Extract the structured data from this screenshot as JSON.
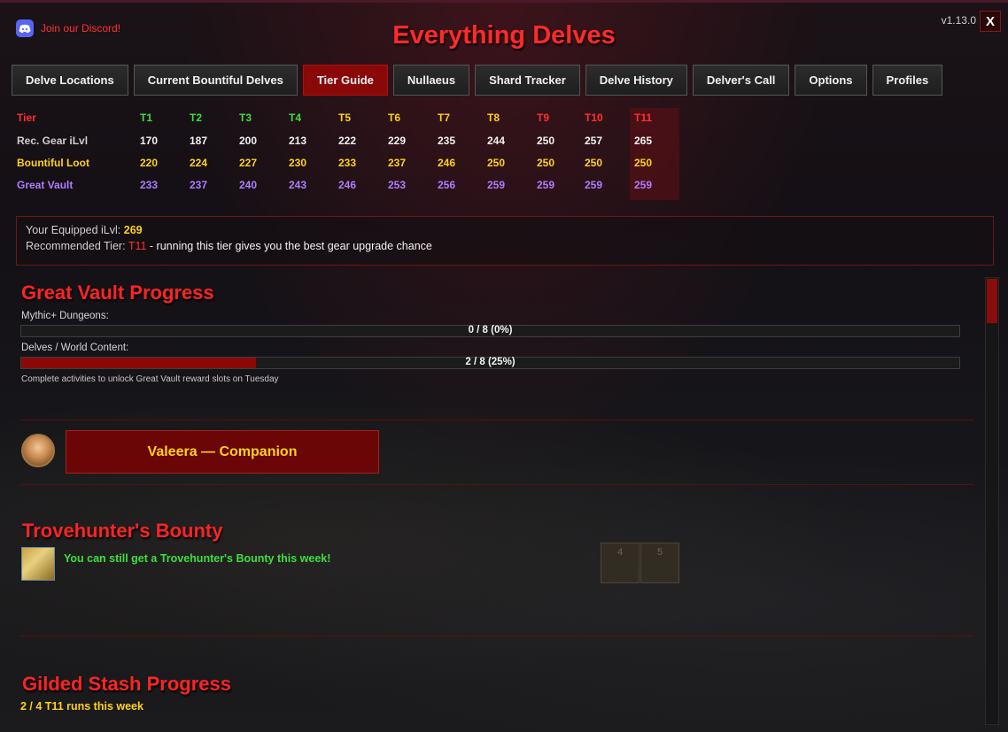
{
  "header": {
    "discord_label": "Join our Discord!",
    "title": "Everything Delves",
    "version": "v1.13.0",
    "close_label": "X"
  },
  "tabs": [
    {
      "label": "Delve Locations",
      "active": false
    },
    {
      "label": "Current Bountiful Delves",
      "active": false
    },
    {
      "label": "Tier Guide",
      "active": true
    },
    {
      "label": "Nullaeus",
      "active": false
    },
    {
      "label": "Shard Tracker",
      "active": false
    },
    {
      "label": "Delve History",
      "active": false
    },
    {
      "label": "Delver's Call",
      "active": false
    },
    {
      "label": "Options",
      "active": false
    },
    {
      "label": "Profiles",
      "active": false
    }
  ],
  "tier_table": {
    "header_label": "Tier",
    "tiers": [
      "T1",
      "T2",
      "T3",
      "T4",
      "T5",
      "T6",
      "T7",
      "T8",
      "T9",
      "T10",
      "T11"
    ],
    "rows": [
      {
        "label": "Rec. Gear iLvl",
        "values": [
          "170",
          "187",
          "200",
          "213",
          "222",
          "229",
          "235",
          "244",
          "250",
          "257",
          "265"
        ]
      },
      {
        "label": "Bountiful Loot",
        "values": [
          "220",
          "224",
          "227",
          "230",
          "233",
          "237",
          "246",
          "250",
          "250",
          "250",
          "250"
        ]
      },
      {
        "label": "Great Vault",
        "values": [
          "233",
          "237",
          "240",
          "243",
          "246",
          "253",
          "256",
          "259",
          "259",
          "259",
          "259"
        ]
      }
    ],
    "highlighted_tier": "T11"
  },
  "info": {
    "equipped_label": "Your Equipped iLvl:",
    "equipped_value": "269",
    "recommended_label": "Recommended Tier:",
    "recommended_value": "T11",
    "recommended_suffix": "- running this tier gives you the best gear upgrade chance"
  },
  "great_vault": {
    "title": "Great Vault Progress",
    "bars": [
      {
        "label": "Mythic+ Dungeons:",
        "text": "0 / 8  (0%)",
        "fraction": 0.0
      },
      {
        "label": "Delves / World Content:",
        "text": "2 / 8  (25%)",
        "fraction": 0.25
      }
    ],
    "note": "Complete activities to unlock Great Vault reward slots on Tuesday"
  },
  "companion": {
    "label": "Valeera — Companion"
  },
  "trovehunter": {
    "title": "Trovehunter's Bounty",
    "message": "You can still get a Trovehunter's Bounty this week!",
    "slots": [
      "4",
      "5"
    ]
  },
  "gilded": {
    "title": "Gilded Stash Progress",
    "text": "2 / 4 T11 runs this week"
  },
  "colors": {
    "accent_red": "#ff2a2a",
    "active_tab": "#8a0808",
    "green": "#3ddf3d",
    "yellow": "#ffd21a",
    "purple": "#b07dff",
    "discord": "#5865f2"
  }
}
